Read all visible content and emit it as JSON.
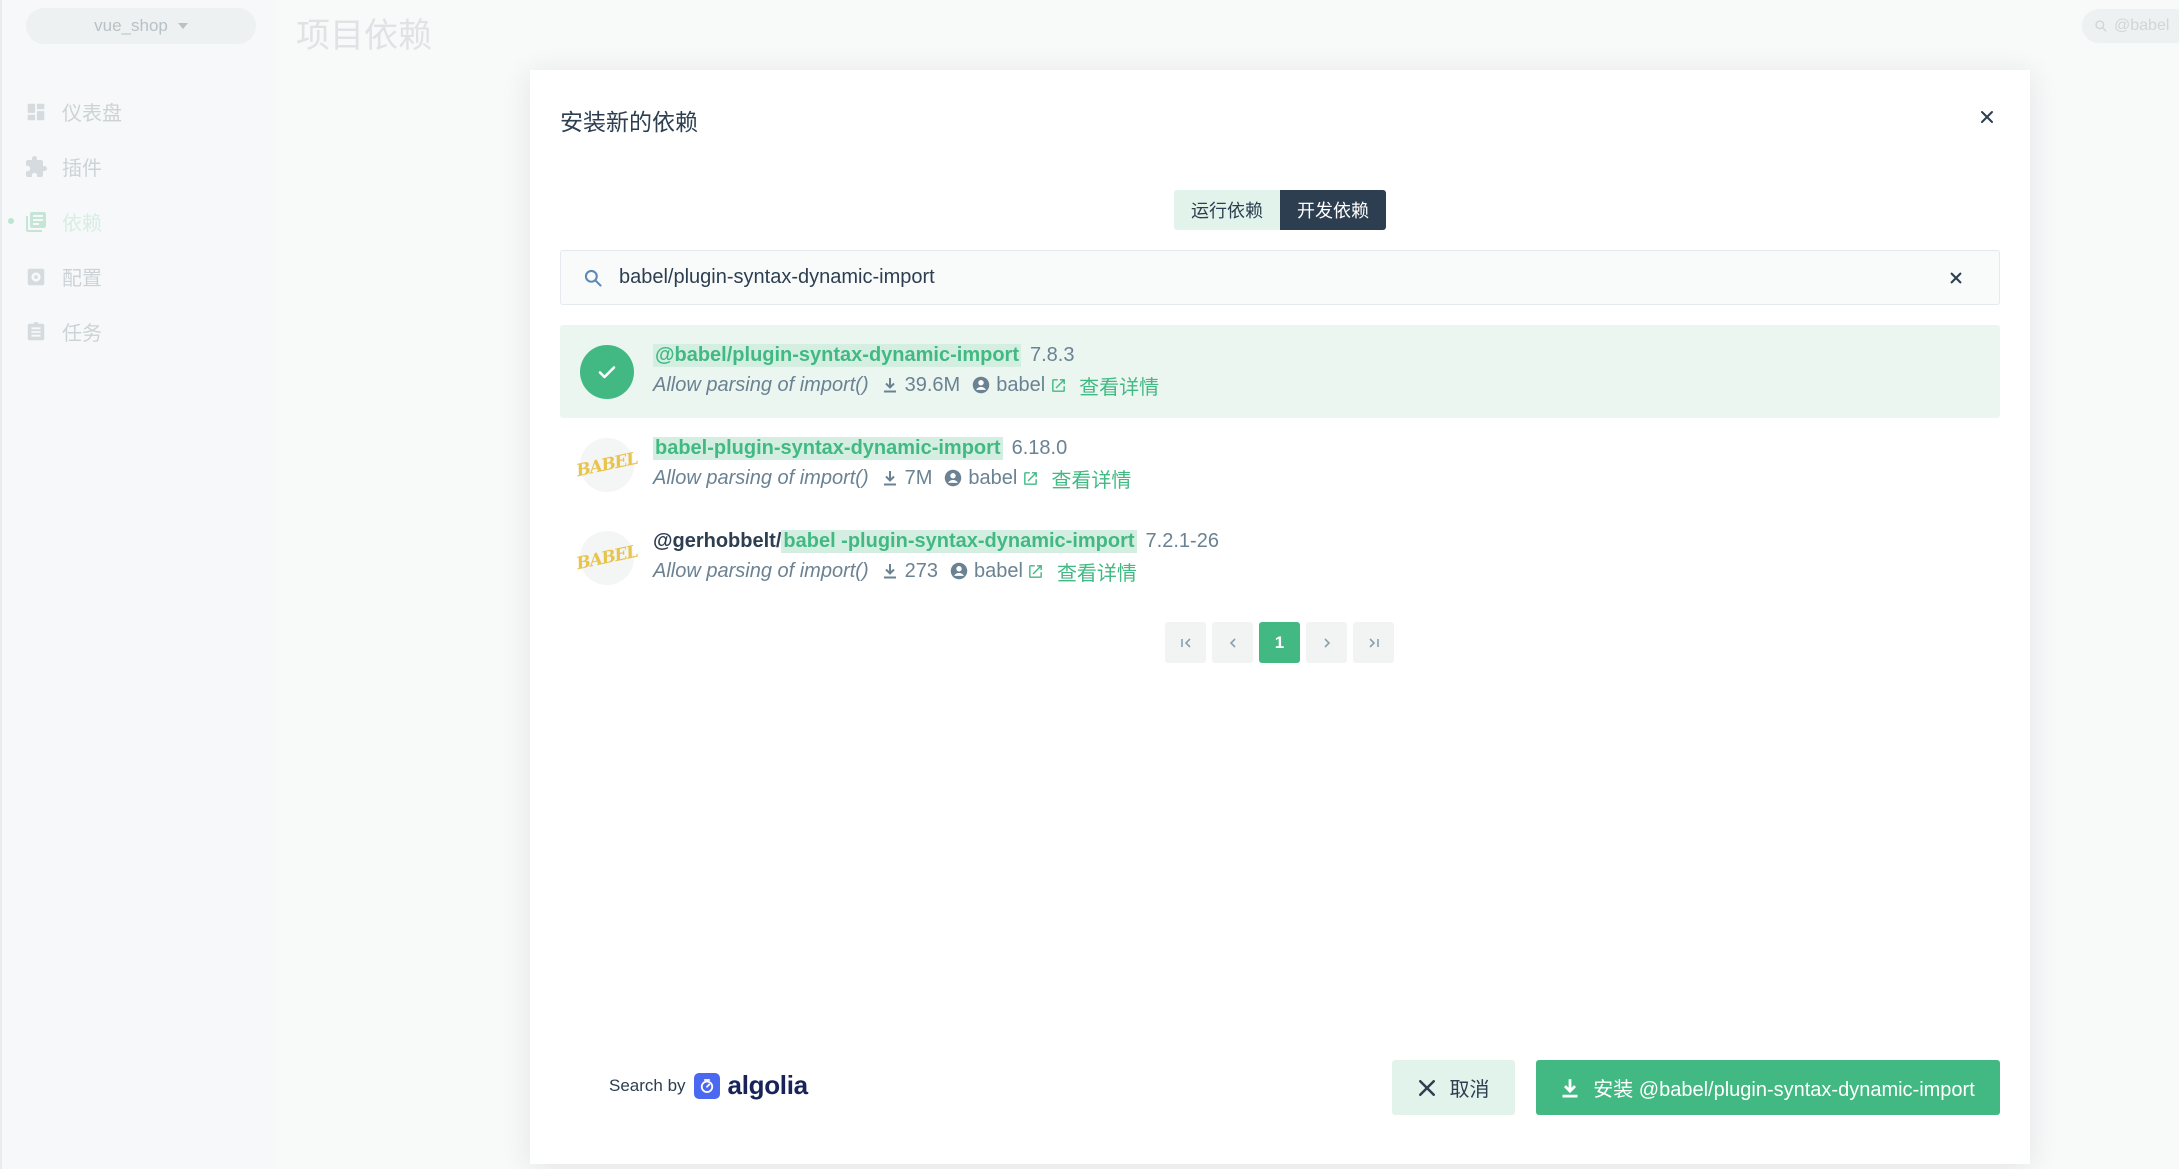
{
  "app": {
    "project_select": "vue_shop",
    "page_title": "项目依赖",
    "top_search_placeholder": "@babel",
    "nav": [
      {
        "label": "仪表盘",
        "icon": "dashboard-icon"
      },
      {
        "label": "插件",
        "icon": "puzzle-icon"
      },
      {
        "label": "依赖",
        "icon": "library-icon"
      },
      {
        "label": "配置",
        "icon": "settings-icon"
      },
      {
        "label": "任务",
        "icon": "clipboard-icon"
      }
    ]
  },
  "modal": {
    "title": "安装新的依赖",
    "tabs": [
      {
        "label": "运行依赖",
        "active": false
      },
      {
        "label": "开发依赖",
        "active": true
      }
    ],
    "search": {
      "value": "babel/plugin-syntax-dynamic-import"
    },
    "results": [
      {
        "scope": "",
        "name": "@babel/plugin-syntax-dynamic-import",
        "version": "7.8.3",
        "description": "Allow parsing of import()",
        "downloads": "39.6M",
        "owner": "babel",
        "link_label": "查看详情",
        "selected": true,
        "avatar": "check-icon"
      },
      {
        "scope": "",
        "name": "babel-plugin-syntax-dynamic-import",
        "version": "6.18.0",
        "description": "Allow parsing of import()",
        "downloads": "7M",
        "owner": "babel",
        "link_label": "查看详情",
        "selected": false,
        "avatar": "babel-logo"
      },
      {
        "scope": "@gerhobbelt/",
        "name": "babel -plugin-syntax-dynamic-import",
        "version": "7.2.1-26",
        "description": "Allow parsing of import()",
        "downloads": "273",
        "owner": "babel",
        "link_label": "查看详情",
        "selected": false,
        "avatar": "babel-logo"
      }
    ],
    "babel_logo_text": "BABEL",
    "pagination": {
      "current": "1"
    },
    "footer": {
      "search_by": "Search by",
      "brand": "algolia",
      "cancel_label": "取消",
      "install_label": "安装 @babel/plugin-syntax-dynamic-import"
    }
  },
  "colors": {
    "accent": "#42b983",
    "accent_light": "#e2f3eb",
    "dark": "#2c3e50",
    "muted": "#6a8292",
    "algolia": "#4a68f0"
  }
}
